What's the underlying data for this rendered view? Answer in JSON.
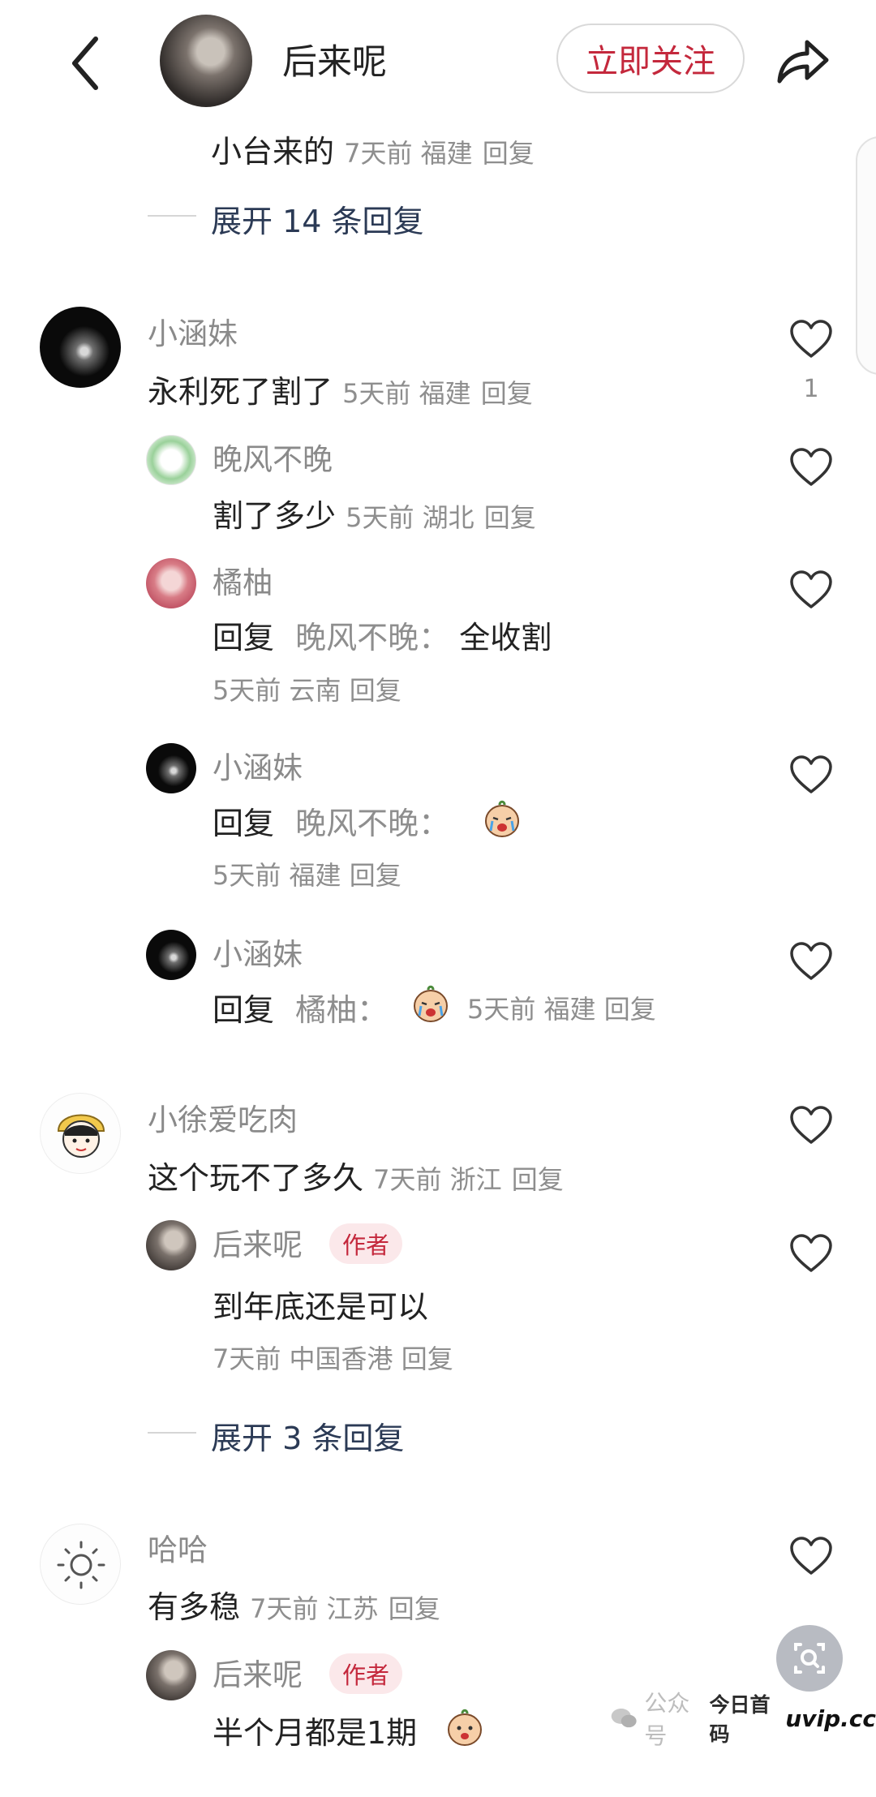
{
  "header": {
    "username": "后来呢",
    "follow_label": "立即关注"
  },
  "top_reply": {
    "text": "小台来的",
    "meta": "7天前 福建",
    "reply_label": "回复",
    "expand_label": "展开 14 条回复"
  },
  "thread1": {
    "name": "小涵妹",
    "text": "永利死了割了",
    "meta": "5天前 福建",
    "reply_label": "回复",
    "likes": "1",
    "replies": [
      {
        "name": "晚风不晚",
        "text": "割了多少",
        "meta": "5天前 湖北",
        "reply_label": "回复"
      },
      {
        "name": "橘柚",
        "prefix": "回复",
        "target": "晚风不晚：",
        "text": "全收割",
        "meta": "5天前 云南",
        "reply_label": "回复"
      },
      {
        "name": "小涵妹",
        "prefix": "回复",
        "target": "晚风不晚：",
        "meta": "5天前 福建",
        "reply_label": "回复"
      },
      {
        "name": "小涵妹",
        "prefix": "回复",
        "target": "橘柚：",
        "meta": "5天前 福建",
        "reply_label": "回复"
      }
    ]
  },
  "thread2": {
    "name": "小徐爱吃肉",
    "text": "这个玩不了多久",
    "meta": "7天前 浙江",
    "reply_label": "回复",
    "author_reply": {
      "name": "后来呢",
      "badge": "作者",
      "text": "到年底还是可以",
      "meta": "7天前 中国香港",
      "reply_label": "回复"
    },
    "expand_label": "展开 3 条回复"
  },
  "thread3": {
    "name": "哈哈",
    "text": "有多稳",
    "meta": "7天前 江苏",
    "reply_label": "回复",
    "author_reply": {
      "name": "后来呢",
      "badge": "作者",
      "text": "半个月都是1期"
    }
  },
  "watermark": {
    "pub_label": "公众号",
    "brand": "今日首码",
    "site": "uvip.cc"
  },
  "colors": {
    "accent": "#c4283c",
    "meta": "#8e8e8e",
    "expand": "#2b3a55"
  }
}
